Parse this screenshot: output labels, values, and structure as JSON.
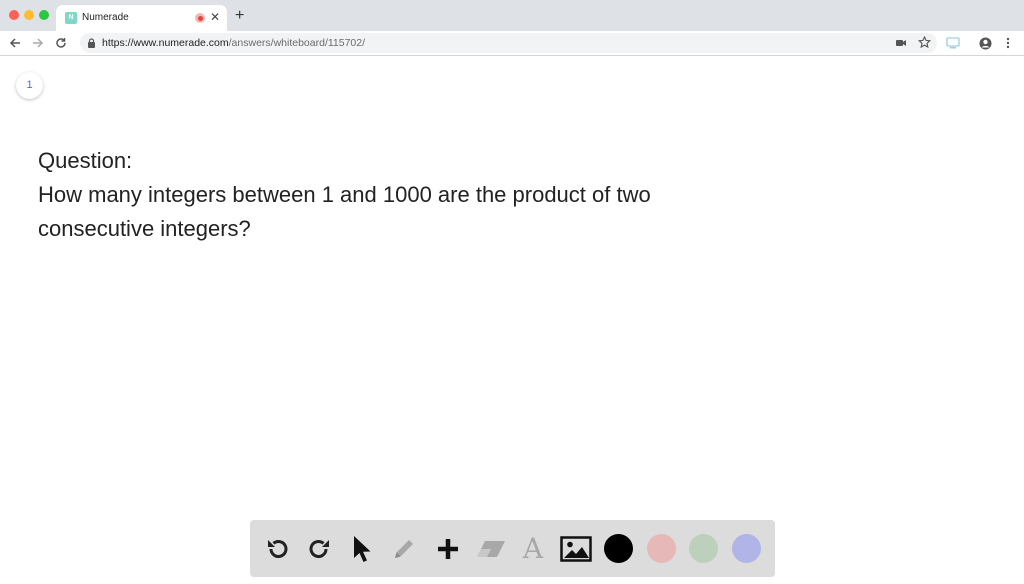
{
  "browser": {
    "tab": {
      "title": "Numerade",
      "favicon_letter": "N"
    },
    "url": {
      "host": "https://www.numerade.com",
      "path": "/answers/whiteboard/115702/"
    }
  },
  "page": {
    "page_number": "1",
    "question_heading": "Question:",
    "question_line1": "How many integers between 1 and 1000 are the product of two",
    "question_line2": "consecutive integers?"
  },
  "whiteboard_toolbar": {
    "tools": [
      "undo-icon",
      "redo-icon",
      "pointer-icon",
      "pencil-icon",
      "add-icon",
      "eraser-icon",
      "text-icon",
      "image-icon"
    ],
    "text_tool_glyph": "A",
    "colors": [
      "#000000",
      "#e6b8b8",
      "#bcd0bc",
      "#b0b4e6"
    ]
  }
}
